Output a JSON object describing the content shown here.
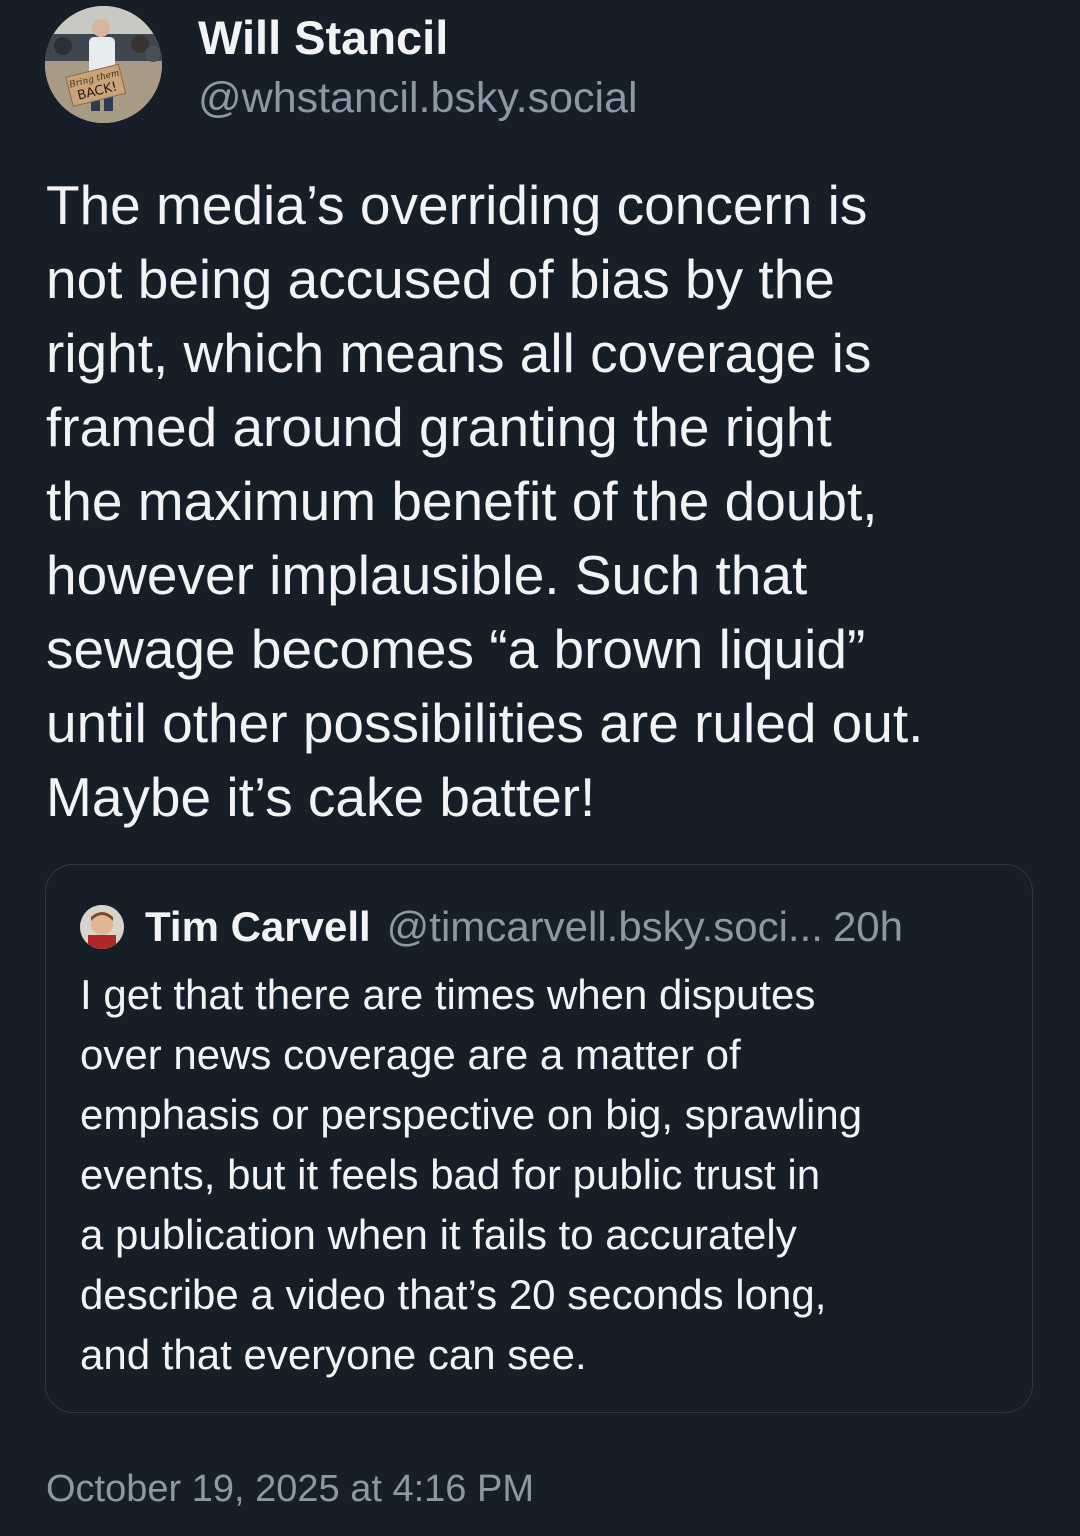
{
  "author": {
    "display_name": "Will Stancil",
    "handle": "@whstancil.bsky.social",
    "avatar_sign_text": "Bring them BACK!"
  },
  "post": {
    "text": "The media’s overriding concern is\nnot being accused of bias by the\nright, which means all coverage is\nframed around granting the right\nthe maximum benefit of the doubt,\nhowever implausible. Such that\nsewage becomes “a brown liquid”\nuntil other possibilities are ruled out.\nMaybe it’s cake batter!",
    "timestamp": "October 19, 2025 at 4:16 PM"
  },
  "quoted_post": {
    "display_name": "Tim Carvell",
    "handle": "@timcarvell.bsky.soci...",
    "relative_time": "20h",
    "text": "I get that there are times when disputes\nover news coverage are a matter of\nemphasis or perspective on big, sprawling\nevents, but it feels bad for public trust in\na publication when it fails to accurately\ndescribe a video that’s 20 seconds long,\nand that everyone can see."
  },
  "colors": {
    "background": "#161e27",
    "primary_text": "#f1f3f5",
    "secondary_text": "#8b98a5",
    "card_border": "#2e3944"
  }
}
